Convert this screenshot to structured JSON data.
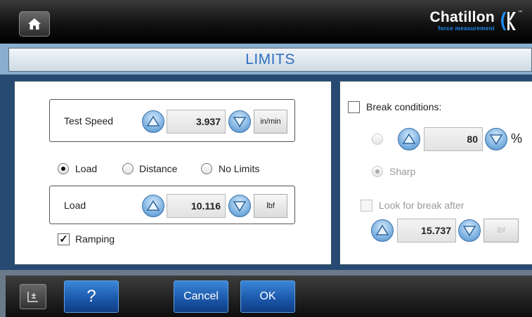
{
  "header": {
    "brand": "Chatillon",
    "brand_sub": "force measurement",
    "brand_tm": "™",
    "home_icon": "home-icon"
  },
  "title": "LIMITS",
  "test_speed": {
    "label": "Test Speed",
    "value": "3.937",
    "unit": "in/min"
  },
  "limit_type": {
    "options": [
      "Load",
      "Distance",
      "No Limits"
    ],
    "selected": "Load"
  },
  "load": {
    "label": "Load",
    "value": "10.116",
    "unit": "lbf"
  },
  "ramping": {
    "label": "Ramping",
    "checked": true
  },
  "break_conditions": {
    "label": "Break conditions:",
    "checked": false,
    "percent_value": "80",
    "percent_unit": "%",
    "sharp_label": "Sharp",
    "look_for_break_label": "Look for break after",
    "look_for_break_checked": false,
    "after_value": "15.737",
    "after_unit": "lbf"
  },
  "footer": {
    "help_label": "?",
    "cancel_label": "Cancel",
    "ok_label": "OK"
  },
  "colors": {
    "accent_blue": "#2f6fc0",
    "button_blue": "#1a56a8",
    "panel_bg": "#264a72",
    "title_bg": "#8aaecd"
  }
}
